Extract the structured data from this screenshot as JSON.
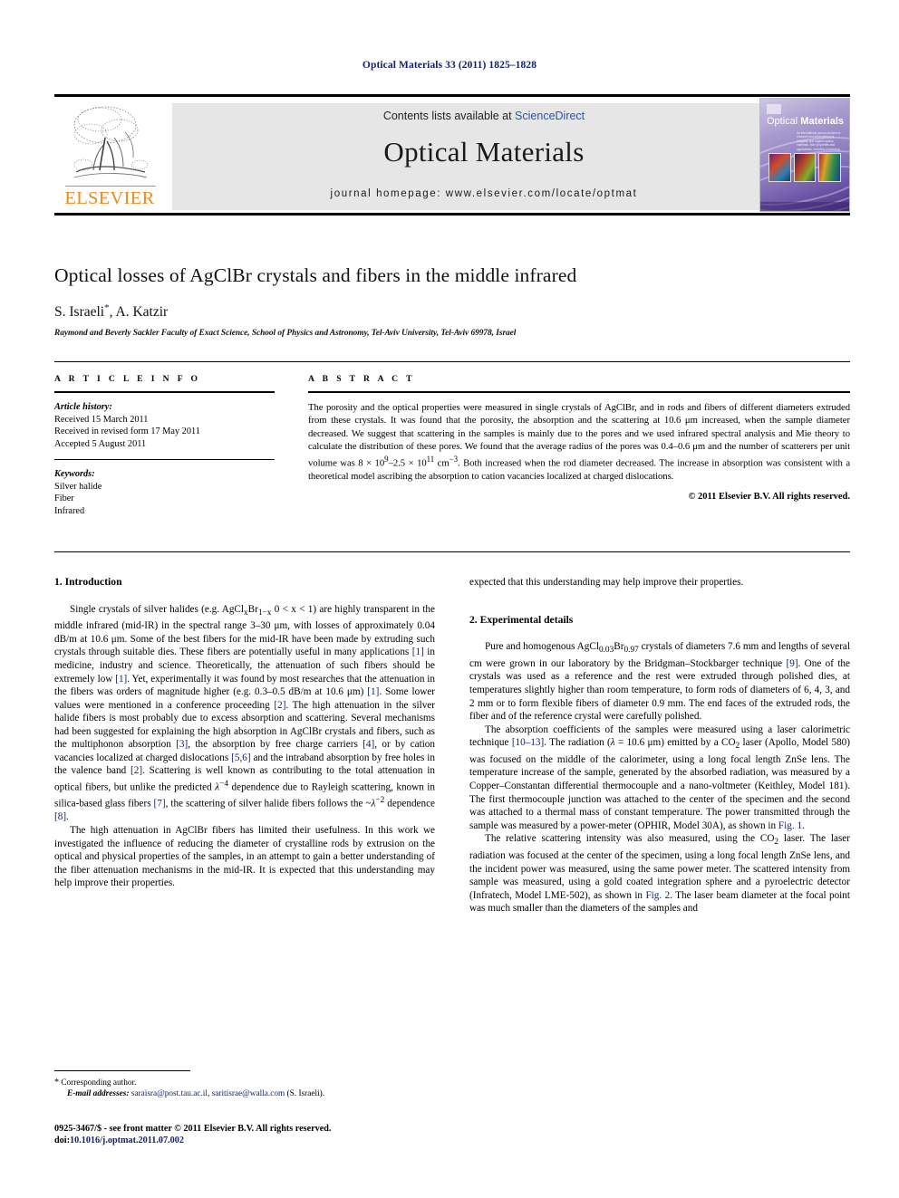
{
  "running_head": "Optical Materials 33 (2011) 1825–1828",
  "masthead": {
    "contents_prefix": "Contents lists available at ",
    "sciencedirect": "ScienceDirect",
    "journal_title": "Optical Materials",
    "homepage": "journal homepage: www.elsevier.com/locate/optmat",
    "publisher_wordmark": "ELSEVIER",
    "cover": {
      "title_light": "Optical ",
      "title_bold": "Materials",
      "subtitle": "An international journal devoted to research and development of inorganic and organic optical materials, their properties and applications, including processing"
    }
  },
  "title_block": {
    "title": "Optical losses of AgClBr crystals and fibers in the middle infrared",
    "authors": "S. Israeli",
    "author_marker": "*",
    "authors_rest": ", A. Katzir",
    "affiliation": "Raymond and Beverly Sackler Faculty of Exact Science, School of Physics and Astronomy, Tel-Aviv University, Tel-Aviv 69978, Israel"
  },
  "article_info": {
    "heading": "A R T I C L E   I N F O",
    "history_label": "Article history:",
    "history": [
      "Received 15 March 2011",
      "Received in revised form 17 May 2011",
      "Accepted 5 August 2011"
    ],
    "keywords_label": "Keywords:",
    "keywords": [
      "Silver halide",
      "Fiber",
      "Infrared"
    ]
  },
  "abstract": {
    "heading": "A B S T R A C T",
    "text_1": "The porosity and the optical properties were measured in single crystals of AgClBr, and in rods and fibers of different diameters extruded from these crystals. It was found that the porosity, the absorption and the scattering at 10.6 ",
    "text_1b": "m increased, when the sample diameter decreased. We suggest that scattering in the samples is mainly due to the pores and we used infrared spectral analysis and Mie theory to calculate the distribution of these pores. We found that the average radius of the pores was 0.4–0.6 ",
    "text_1c": "m and the number of scatterers per unit volume was 8 × 10",
    "exp_1": "9",
    "text_1d": "–2.5 × 10",
    "exp_2": "11",
    "text_1e": " cm",
    "exp_3": "−3",
    "text_1f": ". Both increased when the rod diameter decreased. The increase in absorption was consistent with a theoretical model ascribing the absorption to cation vacancies localized at charged dislocations.",
    "copyright": "© 2011 Elsevier B.V. All rights reserved."
  },
  "body": {
    "intro_heading": "1. Introduction",
    "intro_p1_a": "Single crystals of silver halides (e.g. AgCl",
    "intro_p1_sub1": "x",
    "intro_p1_b": "Br",
    "intro_p1_sub2": "1−x",
    "intro_p1_c": " 0 < x < 1) are highly transparent in the middle infrared (mid-IR) in the spectral range 3–30 ",
    "intro_p1_d": "m, with losses of approximately 0.04 dB/m at 10.6 ",
    "intro_p1_e": "m. Some of the best fibers for the mid-IR have been made by extruding such crystals through suitable dies. These fibers are potentially useful in many applications ",
    "ref_1": "[1]",
    "intro_p1_f": " in medicine, industry and science. Theoretically, the attenuation of such fibers should be extremely low ",
    "intro_p1_g": ". Yet, experimentally it was found by most researches that the attenuation in the fibers was orders of magnitude higher (e.g. 0.3–0.5 dB/m at 10.6 ",
    "intro_p1_h": "m) ",
    "intro_p1_i": ". Some lower values were mentioned in a conference proceeding ",
    "ref_2": "[2]",
    "intro_p1_j": ". The high attenuation in the silver halide fibers is most probably due to excess absorption and scattering. Several mechanisms had been suggested for explaining the high absorption in AgClBr crystals and fibers, such as the multiphonon absorption ",
    "ref_3": "[3]",
    "intro_p1_k": ", the absorption by free charge carriers ",
    "ref_4": "[4]",
    "intro_p1_l": ", or by cation vacancies localized at charged dislocations ",
    "ref_56": "[5,6]",
    "intro_p1_m": " and the intraband absorption by free holes in the valence band ",
    "intro_p1_n": ". Scattering is well known as contributing to the total attenuation in optical fibers, but unlike the predicted ",
    "intro_p1_lam4": "λ",
    "intro_p1_lam4e": "−4",
    "intro_p1_o": " dependence due to Rayleigh scattering, known in silica-based glass fibers ",
    "ref_7": "[7]",
    "intro_p1_p": ", the scattering of silver halide fibers follows the ~",
    "intro_p1_lam2": "λ",
    "intro_p1_lam2e": "−2",
    "intro_p1_q": " dependence ",
    "ref_8": "[8]",
    "intro_p1_r": ".",
    "intro_p2": "The high attenuation in AgClBr fibers has limited their usefulness. In this work we investigated the influence of reducing the diameter of crystalline rods by extrusion on the optical and physical properties of the samples, in an attempt to gain a better understanding of the fiber attenuation mechanisms in the mid-IR. It is expected that this understanding may help improve their properties.",
    "right_cont": "expected that this understanding may help improve their properties.",
    "exp_heading": "2. Experimental details",
    "exp_p1_a": "Pure and homogenous AgCl",
    "exp_p1_sub1": "0.03",
    "exp_p1_b": "Br",
    "exp_p1_sub2": "0.97",
    "exp_p1_c": " crystals of diameters 7.6 mm and lengths of several cm were grown in our laboratory by the Bridgman–Stockbarger technique ",
    "ref_9": "[9]",
    "exp_p1_d": ". One of the crystals was used as a reference and the rest were extruded through polished dies, at temperatures slightly higher than room temperature, to form rods of diameters of 6, 4, 3, and 2 mm or to form flexible fibers of diameter 0.9 mm. The end faces of the extruded rods, the fiber and of the reference crystal were carefully polished.",
    "exp_p2_a": "The absorption coefficients of the samples were measured using a laser calorimetric technique ",
    "ref_1013": "[10–13]",
    "exp_p2_b": ". The radiation (",
    "exp_p2_lam": "λ",
    "exp_p2_c": " = 10.6 ",
    "exp_p2_d": "m) emitted by a CO",
    "exp_p2_sub": "2",
    "exp_p2_e": " laser (Apollo, Model 580) was focused on the middle of the calorimeter, using a long focal length ZnSe lens. The temperature increase of the sample, generated by the absorbed radiation, was measured by a Copper–Constantan differential thermocouple and a nano-voltmeter (Keithley, Model 181). The first thermocouple junction was attached to the center of the specimen and the second was attached to a thermal mass of constant temperature. The power transmitted through the sample was measured by a power-meter (OPHIR, Model 30A), as shown in ",
    "fig_1": "Fig. 1",
    "exp_p2_f": ".",
    "exp_p3_a": "The relative scattering intensity was also measured, using the CO",
    "exp_p3_sub": "2",
    "exp_p3_b": " laser. The laser radiation was focused at the center of the specimen, using a long focal length ZnSe lens, and the incident power was measured, using the same power meter. The scattered intensity from sample was measured, using a gold coated integration sphere and a pyroelectric detector (Infratech, Model LME-502), as shown in ",
    "fig_2": "Fig. 2",
    "exp_p3_c": ". The laser beam diameter at the focal point was much smaller than the diameters of the samples and"
  },
  "footnote": {
    "star": "*",
    "corresponding": " Corresponding author.",
    "email_label": "E-mail addresses:",
    "email_1": "saraisra@post.tau.ac.il",
    "email_sep": ", ",
    "email_2": "saritisrae@walla.com",
    "email_tail": " (S. Israeli).",
    "issn_line": "0925-3467/$ - see front matter © 2011 Elsevier B.V. All rights reserved.",
    "doi_label": "doi:",
    "doi": "10.1016/j.optmat.2011.07.002"
  },
  "colors": {
    "link_blue": "#15226e",
    "sciencedirect_blue": "#2a53b0",
    "elsevier_orange": "#ec8b22",
    "band_grey": "#e6e6e6"
  }
}
